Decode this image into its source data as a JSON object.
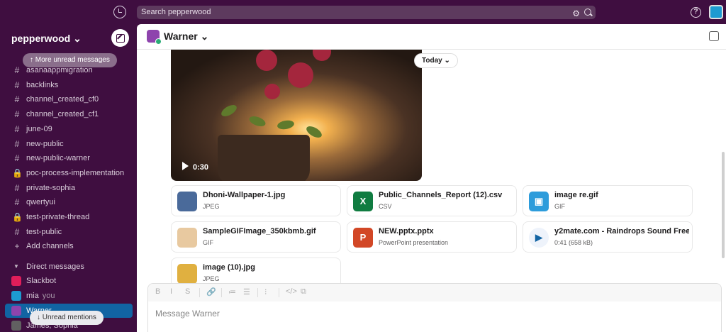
{
  "topbar": {
    "search_placeholder": "Search pepperwood",
    "history_icon": "clock-icon",
    "help_icon": "help-icon"
  },
  "sidebar": {
    "workspace_name": "pepperwood ⌄",
    "unread_pill": "↑ More unread messages",
    "mentions_pill": "↓ Unread mentions",
    "channels": [
      {
        "icon": "#",
        "label": "asanaappmigration"
      },
      {
        "icon": "#",
        "label": "backlinks"
      },
      {
        "icon": "#",
        "label": "channel_created_cf0"
      },
      {
        "icon": "#",
        "label": "channel_created_cf1"
      },
      {
        "icon": "#",
        "label": "june-09"
      },
      {
        "icon": "#",
        "label": "new-public"
      },
      {
        "icon": "#",
        "label": "new-public-warner"
      },
      {
        "icon": "🔒",
        "label": "poc-process-implementation"
      },
      {
        "icon": "#",
        "label": "private-sophia"
      },
      {
        "icon": "#",
        "label": "qwertyui"
      },
      {
        "icon": "🔒",
        "label": "test-private-thread"
      },
      {
        "icon": "#",
        "label": "test-public"
      },
      {
        "icon": "+",
        "label": "Add channels"
      }
    ],
    "dm_section": "Direct messages",
    "dms": [
      {
        "label": "Slackbot",
        "suffix": "",
        "color": "#e01e5a"
      },
      {
        "label": "mia",
        "suffix": "you",
        "color": "#1d9bd1"
      },
      {
        "label": "Warner",
        "suffix": "",
        "color": "#8e44ad"
      },
      {
        "label": "James, Sophia",
        "suffix": "",
        "color": "#616061"
      }
    ]
  },
  "channel": {
    "name": "Warner ⌄",
    "date_divider": "Today ⌄"
  },
  "video": {
    "duration": "0:30"
  },
  "files": [
    {
      "name": "Dhoni-Wallpaper-1.jpg",
      "type": "JPEG",
      "thumb": "",
      "color": "#4a6a9a"
    },
    {
      "name": "Public_Channels_Report (12).csv",
      "type": "CSV",
      "thumb": "X",
      "color": "#107c41"
    },
    {
      "name": "image re.gif",
      "type": "GIF",
      "thumb": "▣",
      "color": "#2d9cdb"
    },
    {
      "name": "SampleGIFImage_350kbmb.gif",
      "type": "GIF",
      "thumb": "",
      "color": "#e8c9a0"
    },
    {
      "name": "NEW.pptx.pptx",
      "type": "PowerPoint presentation",
      "thumb": "P",
      "color": "#d24726"
    },
    {
      "name": "y2mate.com - Raindrops Sound Free...",
      "type": "0:41 (658 kB)",
      "thumb": "▶",
      "color": "#eef3fb"
    },
    {
      "name": "image (10).jpg",
      "type": "JPEG",
      "thumb": "",
      "color": "#e0b040"
    }
  ],
  "composer": {
    "placeholder": "Message Warner",
    "tools": [
      "B",
      "I",
      "S",
      "🔗",
      "≔",
      "☰",
      "⁝",
      "</>",
      "⧉"
    ]
  }
}
